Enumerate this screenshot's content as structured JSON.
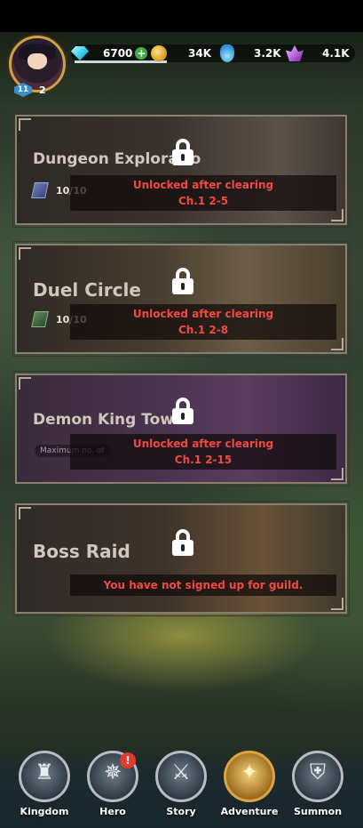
{
  "player": {
    "level": "11",
    "extra": "2"
  },
  "resources": [
    {
      "icon": "gem-icon",
      "value": "6700"
    },
    {
      "icon": "gold-coin-icon",
      "value": "34K"
    },
    {
      "icon": "potion-icon",
      "value": "3.2K"
    },
    {
      "icon": "crystal-icon",
      "value": "4.1K"
    }
  ],
  "modes": [
    {
      "title": "Dungeon Exploratio",
      "count": "10/10",
      "lock_line1": "Unlocked after clearing",
      "lock_line2": "Ch.1 2-5"
    },
    {
      "title": "Duel Circle",
      "count": "10/10",
      "lock_line1": "Unlocked after clearing",
      "lock_line2": "Ch.1 2-8"
    },
    {
      "title": "Demon King Tow",
      "max_text": "Maximum no. of",
      "lock_line1": "Unlocked after clearing",
      "lock_line2": "Ch.1 2-15"
    },
    {
      "title": "Boss Raid",
      "lock_msg": "You have not signed up for guild."
    }
  ],
  "nav": [
    {
      "label": "Kingdom",
      "icon": "castle-icon"
    },
    {
      "label": "Hero",
      "icon": "compass-icon",
      "alert": "!"
    },
    {
      "label": "Story",
      "icon": "story-icon"
    },
    {
      "label": "Adventure",
      "icon": "adventure-icon"
    },
    {
      "label": "Summon",
      "icon": "helmet-icon"
    }
  ],
  "colors": {
    "lock_text": "#ef4a43",
    "panel_border": "#8a7e70",
    "nav_gold": "#d9a441"
  }
}
